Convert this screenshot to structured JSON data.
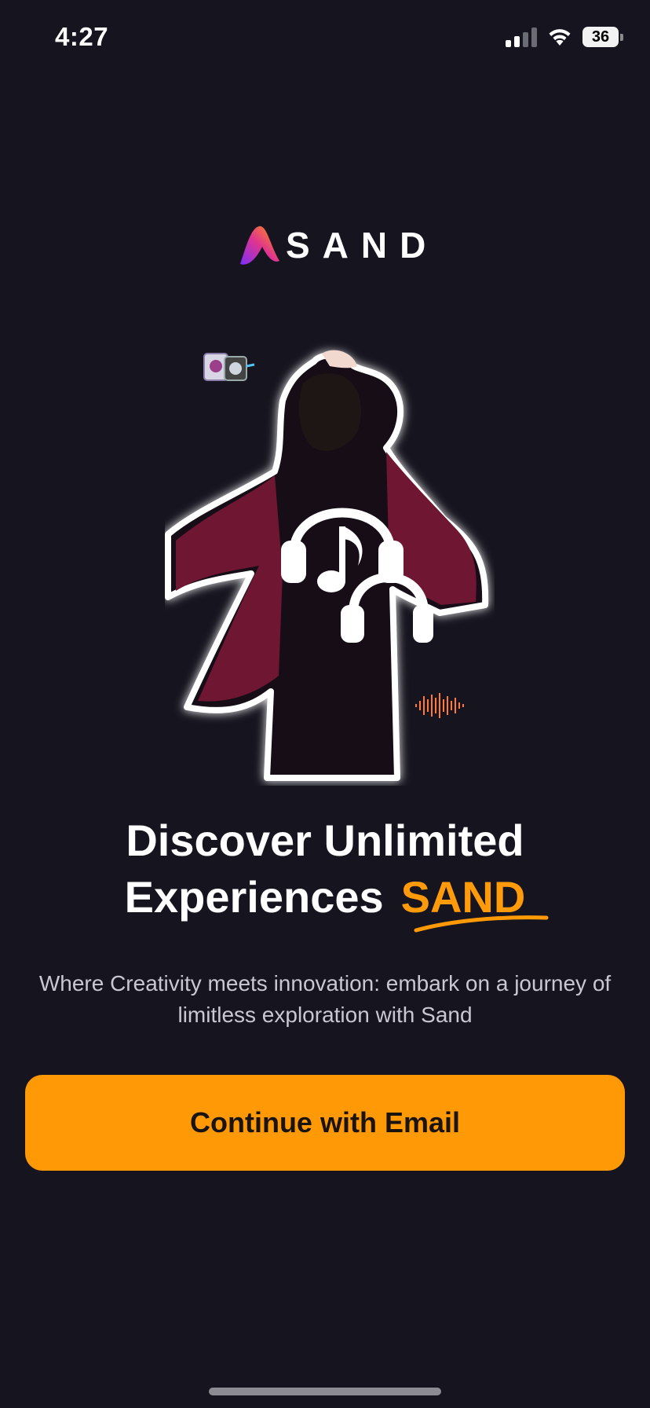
{
  "status_bar": {
    "time": "4:27",
    "battery": "36",
    "icons": [
      "signal-icon",
      "wifi-icon",
      "battery-icon"
    ]
  },
  "logo": {
    "text": "SAND",
    "mark_icon": "sand-logo-icon"
  },
  "hero": {
    "image": "person-with-headphones-illustration",
    "overlay_icon": "headphones-icon"
  },
  "headline": {
    "line1": "Discover Unlimited",
    "line2": "Experiences",
    "brand": "SAND"
  },
  "subtitle": "Where Creativity meets innovation: embark on a journey of limitless exploration with Sand",
  "cta": {
    "label": "Continue with Email"
  },
  "colors": {
    "background": "#16151f",
    "accent": "#ff9a06",
    "text": "#ffffff",
    "muted": "#c9c8d0"
  }
}
